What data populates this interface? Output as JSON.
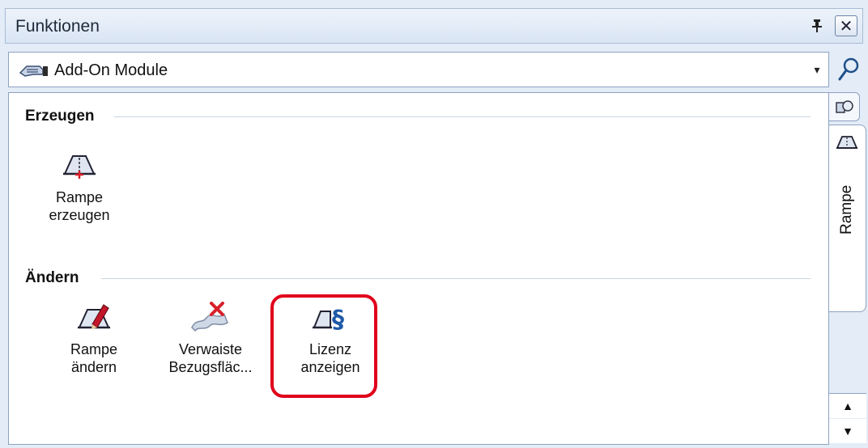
{
  "panel": {
    "title": "Funktionen",
    "pin_glyph": "Ș",
    "close_glyph": "✕"
  },
  "combo": {
    "value": "Add-On Module",
    "arrow_glyph": "▾",
    "icon": "module-hand-icon"
  },
  "groups": {
    "create": {
      "label": "Erzeugen",
      "tools": [
        {
          "line1": "Rampe",
          "line2": "erzeugen",
          "icon": "ramp-create-icon"
        }
      ]
    },
    "modify": {
      "label": "Ändern",
      "tools": [
        {
          "line1": "Rampe",
          "line2": "ändern",
          "icon": "ramp-edit-icon"
        },
        {
          "line1": "Verwaiste",
          "line2": "Bezugsfläc...",
          "icon": "orphan-surface-delete-icon"
        },
        {
          "line1": "Lizenz",
          "line2": "anzeigen",
          "icon": "license-show-icon"
        }
      ]
    }
  },
  "tabs": {
    "active_label": "Rampe",
    "scroll_up_glyph": "▲",
    "scroll_down_glyph": "▼"
  },
  "colors": {
    "highlight": "#e0001b",
    "accent": "#8da2c2"
  }
}
